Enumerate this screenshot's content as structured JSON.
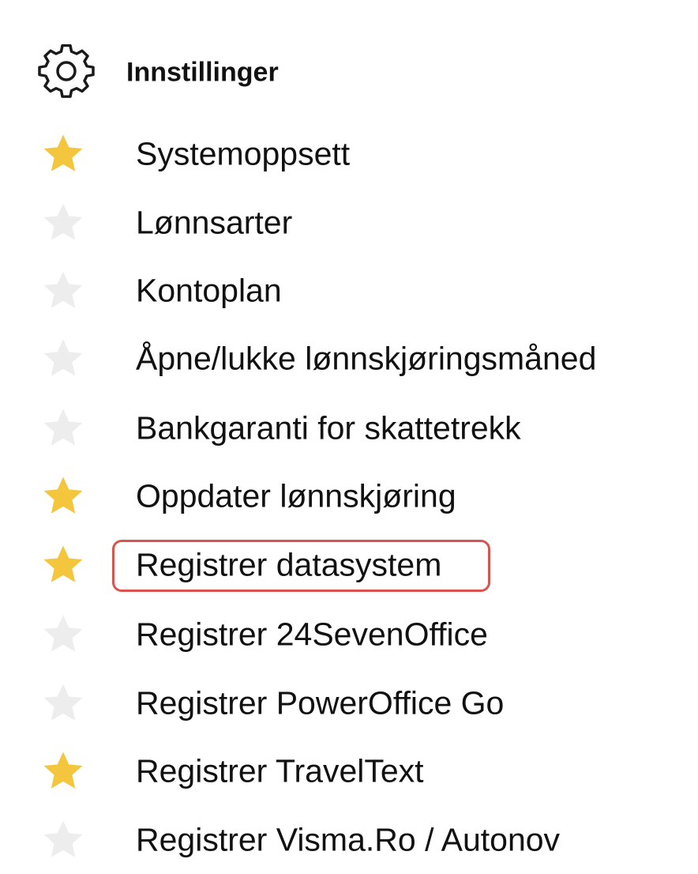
{
  "settings": {
    "title": "Innstillinger",
    "icon": "gear-icon"
  },
  "colors": {
    "star_active": "#f4c63d",
    "star_inactive": "#ededed",
    "highlight_border": "#d9534f"
  },
  "menu": {
    "items": [
      {
        "label": "Systemoppsett",
        "favorite": true
      },
      {
        "label": "Lønnsarter",
        "favorite": false
      },
      {
        "label": "Kontoplan",
        "favorite": false
      },
      {
        "label": "Åpne/lukke lønnskjøringsmåned",
        "favorite": false
      },
      {
        "label": "Bankgaranti for skattetrekk",
        "favorite": false
      },
      {
        "label": "Oppdater lønnskjøring",
        "favorite": true
      },
      {
        "label": "Registrer datasystem",
        "favorite": true,
        "highlighted": true
      },
      {
        "label": "Registrer 24SevenOffice",
        "favorite": false
      },
      {
        "label": "Registrer PowerOffice Go",
        "favorite": false
      },
      {
        "label": "Registrer TravelText",
        "favorite": true
      },
      {
        "label": "Registrer Visma.Ro / Autonov",
        "favorite": false
      }
    ]
  }
}
